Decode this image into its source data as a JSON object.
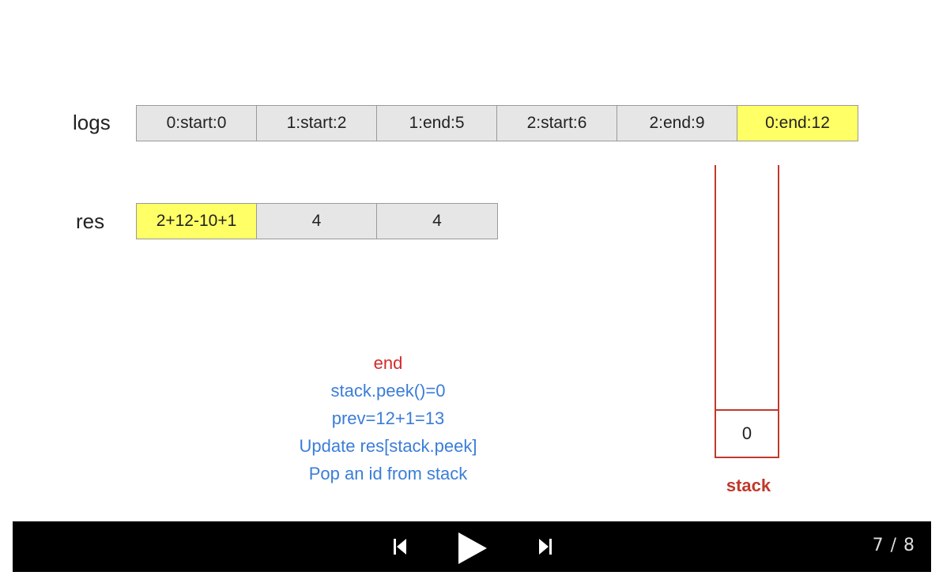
{
  "logs": {
    "label": "logs",
    "cells": [
      {
        "text": "0:start:0",
        "highlight": false
      },
      {
        "text": "1:start:2",
        "highlight": false
      },
      {
        "text": "1:end:5",
        "highlight": false
      },
      {
        "text": "2:start:6",
        "highlight": false
      },
      {
        "text": "2:end:9",
        "highlight": false
      },
      {
        "text": "0:end:12",
        "highlight": true
      }
    ]
  },
  "res": {
    "label": "res",
    "cells": [
      {
        "text": "2+12-10+1",
        "highlight": true
      },
      {
        "text": "4",
        "highlight": false
      },
      {
        "text": "4",
        "highlight": false
      }
    ]
  },
  "notes": {
    "line1": "end",
    "line2": "stack.peek()=0",
    "line3": "prev=12+1=13",
    "line4": "Update res[stack.peek]",
    "line5": "Pop an id from stack"
  },
  "stack": {
    "label": "stack",
    "items": [
      "0"
    ]
  },
  "player": {
    "counter": "7 / 8",
    "prev_icon": "skip-previous-icon",
    "play_icon": "play-icon",
    "next_icon": "skip-next-icon"
  },
  "colors": {
    "highlight": "#ffff66",
    "cell": "#e6e6e6",
    "stack": "#c0392b",
    "note_red": "#d42a2a",
    "note_blue": "#3b7dd8"
  }
}
